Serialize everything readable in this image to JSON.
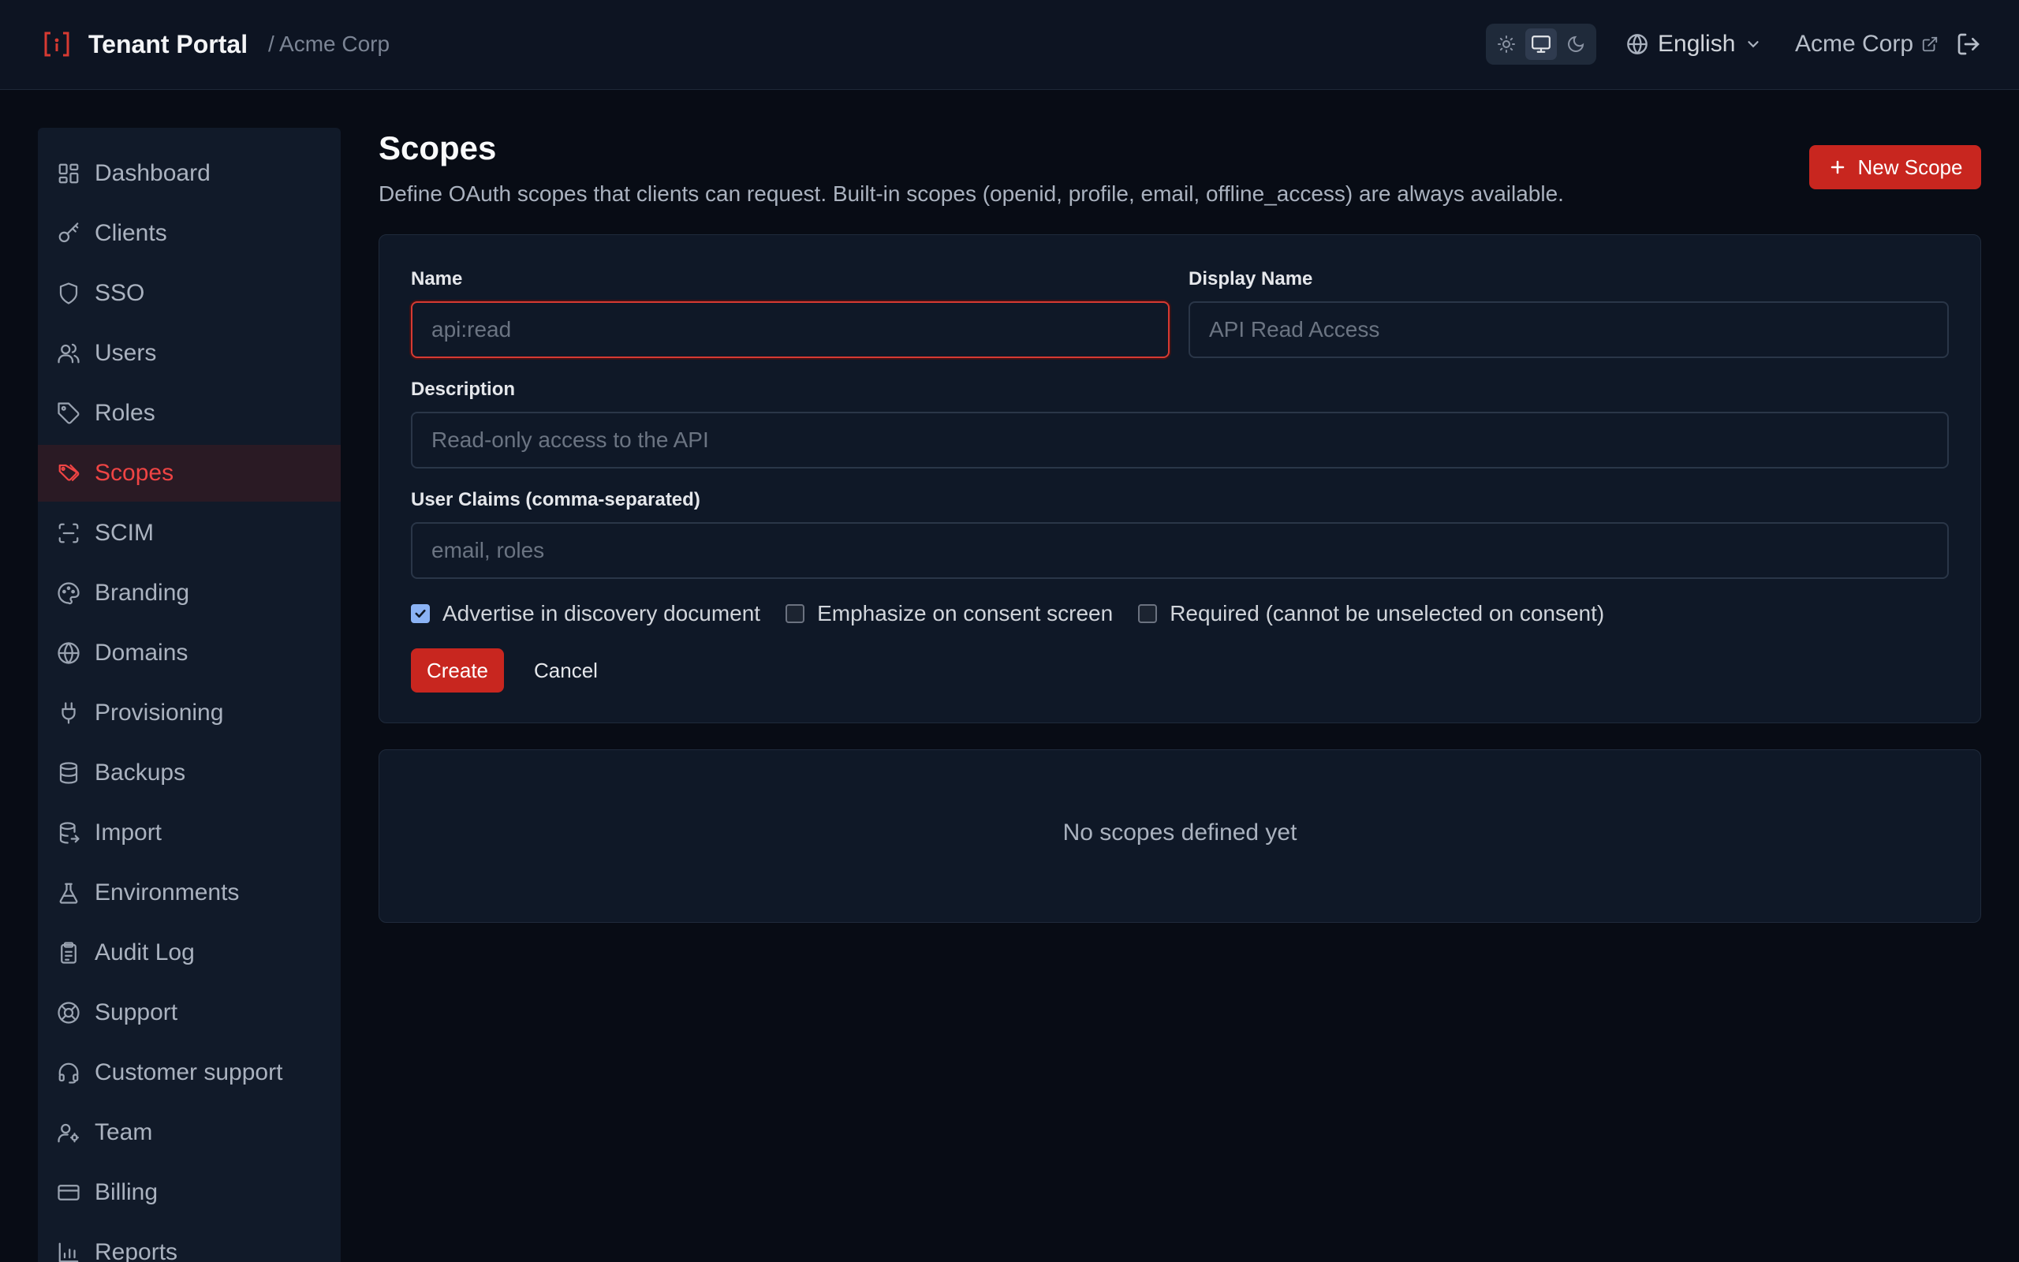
{
  "header": {
    "app_title": "Tenant Portal",
    "breadcrumb": "/ Acme Corp",
    "language": "English",
    "tenant_link": "Acme Corp"
  },
  "sidebar": {
    "items": [
      {
        "label": "Dashboard",
        "icon": "dashboard-icon"
      },
      {
        "label": "Clients",
        "icon": "key-icon"
      },
      {
        "label": "SSO",
        "icon": "shield-icon"
      },
      {
        "label": "Users",
        "icon": "users-icon"
      },
      {
        "label": "Roles",
        "icon": "tag-icon"
      },
      {
        "label": "Scopes",
        "icon": "tags-icon",
        "active": true
      },
      {
        "label": "SCIM",
        "icon": "scan-icon"
      },
      {
        "label": "Branding",
        "icon": "palette-icon"
      },
      {
        "label": "Domains",
        "icon": "globe-icon"
      },
      {
        "label": "Provisioning",
        "icon": "plug-icon"
      },
      {
        "label": "Backups",
        "icon": "database-icon"
      },
      {
        "label": "Import",
        "icon": "database-import-icon"
      },
      {
        "label": "Environments",
        "icon": "flask-icon"
      },
      {
        "label": "Audit Log",
        "icon": "clipboard-icon"
      },
      {
        "label": "Support",
        "icon": "life-buoy-icon"
      },
      {
        "label": "Customer support",
        "icon": "headset-icon"
      },
      {
        "label": "Team",
        "icon": "user-cog-icon"
      },
      {
        "label": "Billing",
        "icon": "credit-card-icon"
      },
      {
        "label": "Reports",
        "icon": "bar-chart-icon"
      }
    ]
  },
  "main": {
    "title": "Scopes",
    "description": "Define OAuth scopes that clients can request. Built-in scopes (openid, profile, email, offline_access) are always available.",
    "new_button": "New Scope",
    "form": {
      "name_label": "Name",
      "name_placeholder": "api:read",
      "name_value": "",
      "display_name_label": "Display Name",
      "display_name_placeholder": "API Read Access",
      "description_label": "Description",
      "description_placeholder": "Read-only access to the API",
      "claims_label": "User Claims (comma-separated)",
      "claims_placeholder": "email, roles",
      "checkboxes": [
        {
          "label": "Advertise in discovery document",
          "checked": true
        },
        {
          "label": "Emphasize on consent screen",
          "checked": false
        },
        {
          "label": "Required (cannot be unselected on consent)",
          "checked": false
        }
      ],
      "create_button": "Create",
      "cancel_button": "Cancel"
    },
    "empty_state": "No scopes defined yet"
  },
  "colors": {
    "accent": "#c8261f",
    "background": "#080c15",
    "panel": "#111a29"
  }
}
